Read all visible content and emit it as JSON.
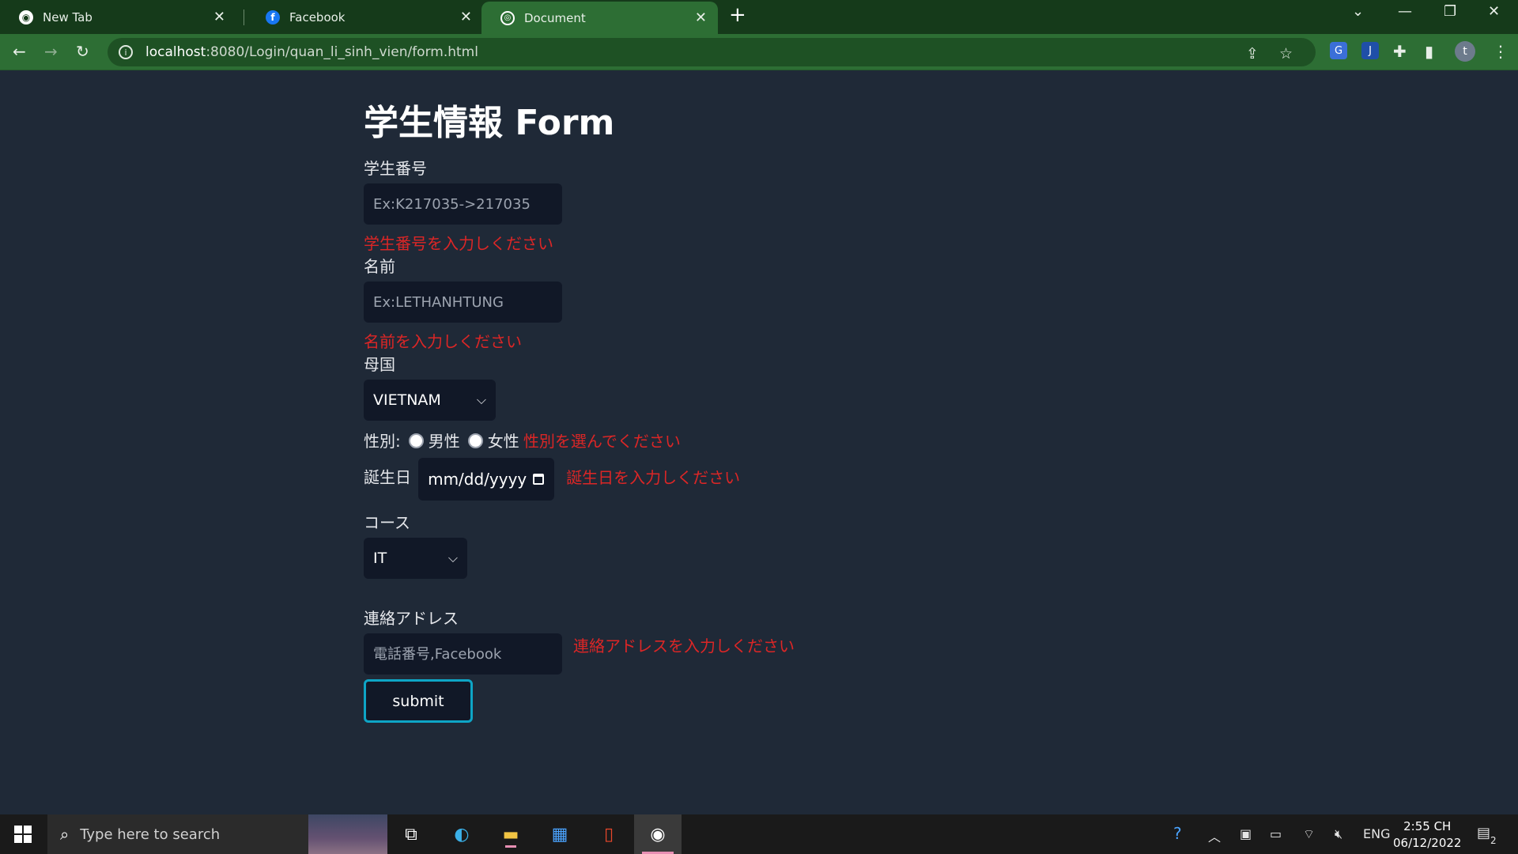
{
  "browser": {
    "tabs": [
      {
        "title": "New Tab",
        "icon": "chrome-icon"
      },
      {
        "title": "Facebook",
        "icon": "facebook-icon"
      },
      {
        "title": "Document",
        "icon": "globe-icon",
        "active": true
      }
    ],
    "url_host": "localhost",
    "url_rest": ":8080/Login/quan_li_sinh_vien/form.html",
    "profile_initial": "t"
  },
  "form": {
    "title": "学生情報 Form",
    "student_id": {
      "label": "学生番号",
      "placeholder": "Ex:K217035->217035",
      "error": "学生番号を入力しください"
    },
    "name": {
      "label": "名前",
      "placeholder": "Ex:LETHANHTUNG",
      "error": "名前を入力しください"
    },
    "country": {
      "label": "母国",
      "selected": "VIETNAM"
    },
    "gender": {
      "label": "性別:",
      "options": [
        "男性",
        "女性"
      ],
      "error": "性別を選んでください"
    },
    "birthday": {
      "label": "誕生日",
      "placeholder": "mm/dd/yyyy",
      "error": "誕生日を入力しください"
    },
    "course": {
      "label": "コース",
      "selected": "IT"
    },
    "contact": {
      "label": "連絡アドレス",
      "placeholder": "電話番号,Facebook",
      "error": "連絡アドレスを入力しください"
    },
    "submit_label": "submit"
  },
  "taskbar": {
    "search_placeholder": "Type here to search",
    "language": "ENG",
    "time": "2:55 CH",
    "date": "06/12/2022",
    "notification_count": "2"
  },
  "colors": {
    "accent": "#2d6e34",
    "page_bg": "#1f2937",
    "error": "#dc2626",
    "submit_border": "#0ea5c6"
  }
}
